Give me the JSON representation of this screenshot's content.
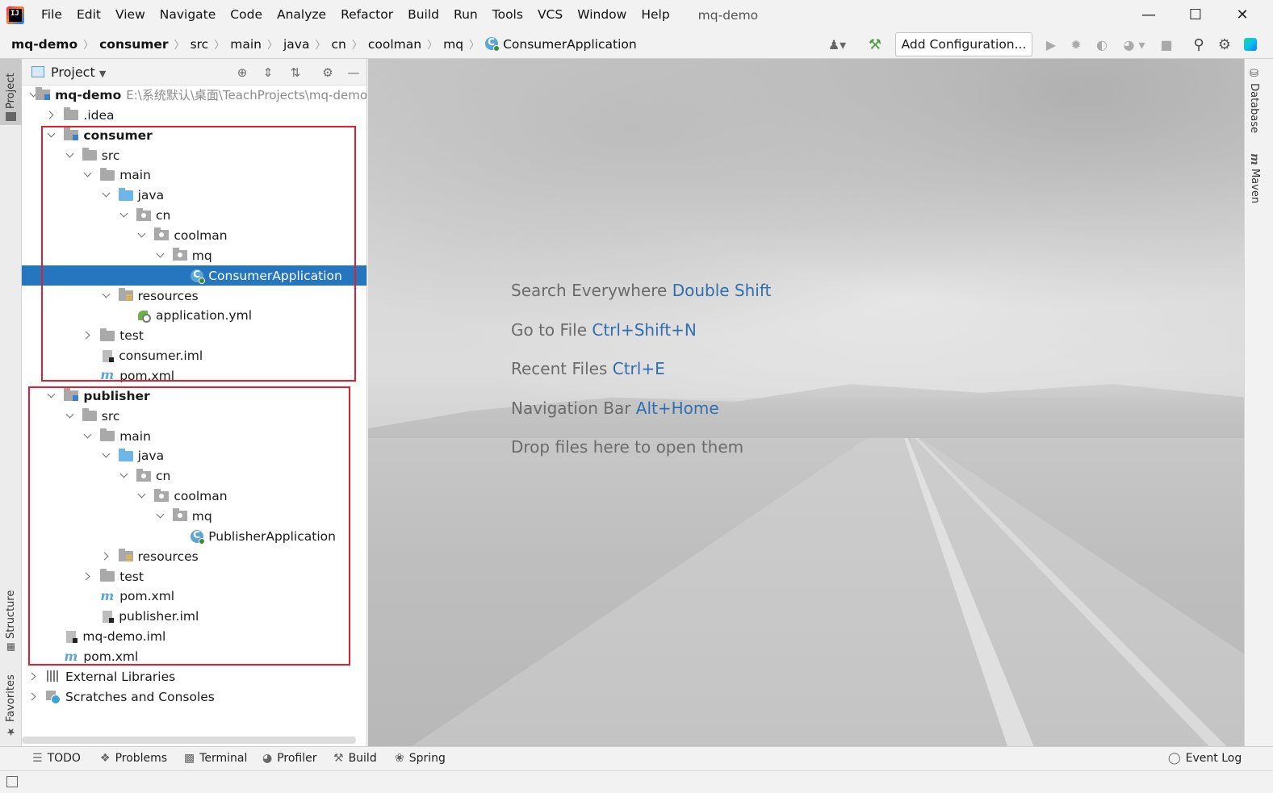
{
  "app": {
    "logo_text": "IJ",
    "window_title": "mq-demo",
    "menu": [
      "File",
      "Edit",
      "View",
      "Navigate",
      "Code",
      "Analyze",
      "Refactor",
      "Build",
      "Run",
      "Tools",
      "VCS",
      "Window",
      "Help"
    ],
    "window_controls": {
      "minimize": "—",
      "maximize": "☐",
      "close": "✕"
    }
  },
  "navbar": {
    "breadcrumbs": [
      "mq-demo",
      "consumer",
      "src",
      "main",
      "java",
      "cn",
      "coolman",
      "mq",
      "ConsumerApplication"
    ],
    "separator": "〉",
    "add_config_label": "Add Configuration...",
    "toolbar_icons": [
      "user-icon",
      "hammer-icon",
      "run-icon",
      "debug-icon",
      "coverage-icon",
      "profile-icon",
      "stop-icon",
      "search-icon",
      "gear-icon",
      "toolbox-icon"
    ]
  },
  "left_stripe": {
    "project_label": "Project",
    "structure_label": "Structure",
    "favorites_label": "Favorites"
  },
  "right_stripe": {
    "database_label": "Database",
    "maven_label": "Maven"
  },
  "project_panel": {
    "title": "Project",
    "tree": [
      {
        "label": "mq-demo",
        "path": "E:\\系统默认\\桌面\\TeachProjects\\mq-demo",
        "icon": "module",
        "arrow": "open",
        "bold": true
      },
      {
        "label": ".idea",
        "icon": "folder",
        "arrow": "closed"
      },
      {
        "label": "consumer",
        "icon": "module",
        "arrow": "open",
        "bold": true
      },
      {
        "label": "src",
        "icon": "folder",
        "arrow": "open"
      },
      {
        "label": "main",
        "icon": "folder",
        "arrow": "open"
      },
      {
        "label": "java",
        "icon": "folder-src",
        "arrow": "open"
      },
      {
        "label": "cn",
        "icon": "package",
        "arrow": "open"
      },
      {
        "label": "coolman",
        "icon": "package",
        "arrow": "open"
      },
      {
        "label": "mq",
        "icon": "package",
        "arrow": "open"
      },
      {
        "label": "ConsumerApplication",
        "icon": "class",
        "arrow": "none",
        "selected": true
      },
      {
        "label": "resources",
        "icon": "resources",
        "arrow": "open"
      },
      {
        "label": "application.yml",
        "icon": "yml",
        "arrow": "none"
      },
      {
        "label": "test",
        "icon": "folder",
        "arrow": "closed"
      },
      {
        "label": "consumer.iml",
        "icon": "iml",
        "arrow": "none"
      },
      {
        "label": "pom.xml",
        "icon": "maven",
        "arrow": "none"
      },
      {
        "label": "publisher",
        "icon": "module",
        "arrow": "open",
        "bold": true
      },
      {
        "label": "src",
        "icon": "folder",
        "arrow": "open"
      },
      {
        "label": "main",
        "icon": "folder",
        "arrow": "open"
      },
      {
        "label": "java",
        "icon": "folder-src",
        "arrow": "open"
      },
      {
        "label": "cn",
        "icon": "package",
        "arrow": "open"
      },
      {
        "label": "coolman",
        "icon": "package",
        "arrow": "open"
      },
      {
        "label": "mq",
        "icon": "package",
        "arrow": "open"
      },
      {
        "label": "PublisherApplication",
        "icon": "class",
        "arrow": "none"
      },
      {
        "label": "resources",
        "icon": "resources",
        "arrow": "closed"
      },
      {
        "label": "test",
        "icon": "folder",
        "arrow": "closed"
      },
      {
        "label": "pom.xml",
        "icon": "maven",
        "arrow": "none"
      },
      {
        "label": "publisher.iml",
        "icon": "iml",
        "arrow": "none"
      },
      {
        "label": "mq-demo.iml",
        "icon": "iml",
        "arrow": "none"
      },
      {
        "label": "pom.xml",
        "icon": "maven",
        "arrow": "none"
      },
      {
        "label": "External Libraries",
        "icon": "libs",
        "arrow": "closed"
      },
      {
        "label": "Scratches and Consoles",
        "icon": "scratch",
        "arrow": "closed"
      }
    ]
  },
  "editor": {
    "hints": [
      {
        "text": "Search Everywhere",
        "shortcut": "Double Shift"
      },
      {
        "text": "Go to File",
        "shortcut": "Ctrl+Shift+N"
      },
      {
        "text": "Recent Files",
        "shortcut": "Ctrl+E"
      },
      {
        "text": "Navigation Bar",
        "shortcut": "Alt+Home"
      },
      {
        "text": "Drop files here to open them",
        "shortcut": ""
      }
    ]
  },
  "bottom_bar": {
    "tabs": [
      "TODO",
      "Problems",
      "Terminal",
      "Profiler",
      "Build",
      "Spring"
    ],
    "event_log": "Event Log"
  },
  "colors": {
    "selection": "#2675bf",
    "highlight_box": "#e0202e",
    "shortcut_text": "#2f6fb0"
  }
}
